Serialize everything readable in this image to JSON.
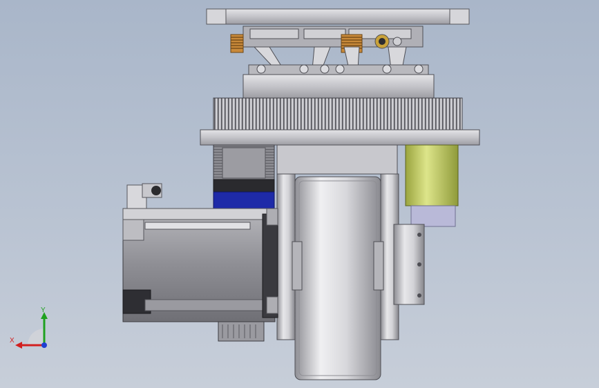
{
  "viewport": {
    "background_top": "#a9b6c9",
    "background_bottom": "#c7ced9"
  },
  "model": {
    "components": [
      "top-mount-plate",
      "suspension-spring-assembly",
      "slewing-gear-ring",
      "base-plate",
      "stepper-motor",
      "servo-motor",
      "cable-connector",
      "drive-wheel",
      "wheel-fork-bracket",
      "encoder-cylinder"
    ],
    "colors": {
      "steel": "#c9c9cd",
      "steel_dark": "#8d8d93",
      "motor_body": "#9a9aa0",
      "motor_dark": "#3a3a3f",
      "blue_band": "#1e2aa8",
      "encoder_yellow": "#c7d36a",
      "encoder_lavender": "#b9b9d8",
      "spring_orange": "#c98a3a"
    }
  },
  "triad": {
    "x_label": "X",
    "y_label": "Y",
    "x_color": "#d21f1f",
    "y_color": "#1fa11f",
    "z_color": "#1f3fd2"
  }
}
